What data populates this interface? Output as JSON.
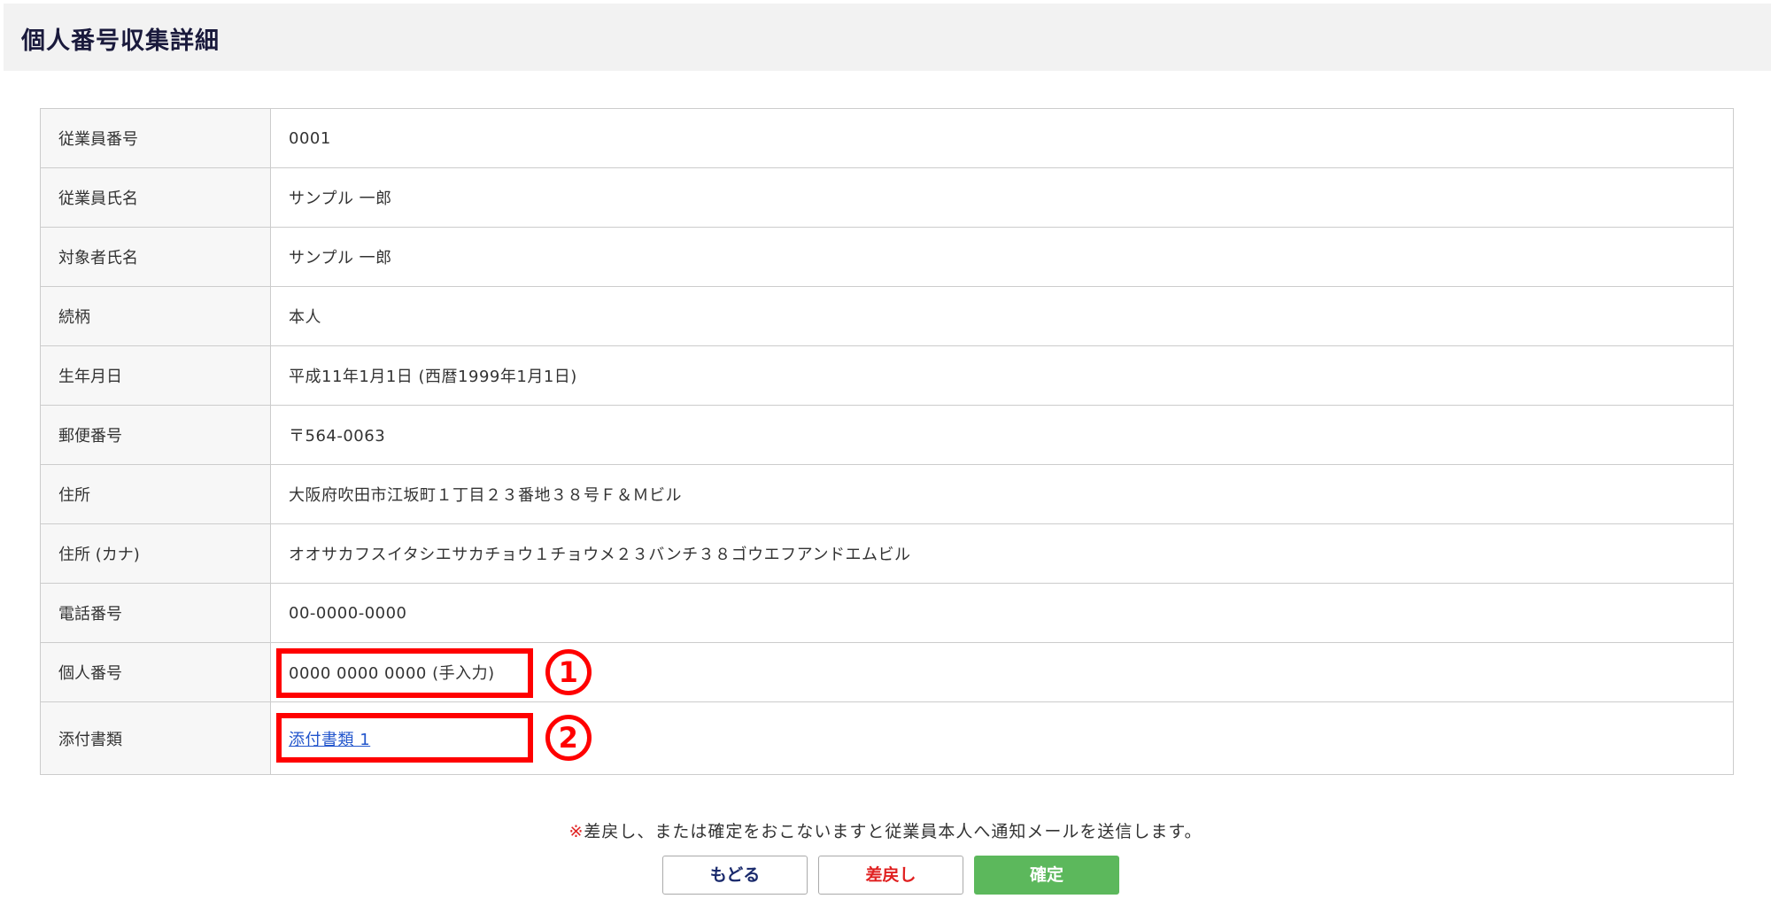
{
  "page": {
    "title": "個人番号収集詳細"
  },
  "fields": [
    {
      "label": "従業員番号",
      "value": "0001"
    },
    {
      "label": "従業員氏名",
      "value": "サンプル 一郎"
    },
    {
      "label": "対象者氏名",
      "value": "サンプル 一郎"
    },
    {
      "label": "続柄",
      "value": "本人"
    },
    {
      "label": "生年月日",
      "value": "平成11年1月1日 (西暦1999年1月1日)"
    },
    {
      "label": "郵便番号",
      "value": "〒564-0063"
    },
    {
      "label": "住所",
      "value": "大阪府吹田市江坂町１丁目２３番地３８号Ｆ＆Ｍビル"
    },
    {
      "label": "住所 (カナ)",
      "value": "オオサカフスイタシエサカチョウ１チョウメ２３バンチ３８ゴウエフアンドエムビル"
    },
    {
      "label": "電話番号",
      "value": "00-0000-0000"
    },
    {
      "label": "個人番号",
      "value": "0000 0000 0000 (手入力)"
    }
  ],
  "attachment": {
    "label": "添付書類",
    "link_text": "添付書類 1"
  },
  "callouts": {
    "one": "1",
    "two": "2"
  },
  "notice": {
    "mark": "※",
    "text": "差戻し、または確定をおこないますと従業員本人へ通知メールを送信します。"
  },
  "buttons": {
    "back": "もどる",
    "return": "差戻し",
    "confirm": "確定"
  },
  "colors": {
    "header_bg": "#f2f2f2",
    "title": "#1a1a3c",
    "callout": "#ff0000",
    "confirm_bg": "#5cb85c",
    "return_text": "#e02020",
    "link": "#2255cc"
  }
}
